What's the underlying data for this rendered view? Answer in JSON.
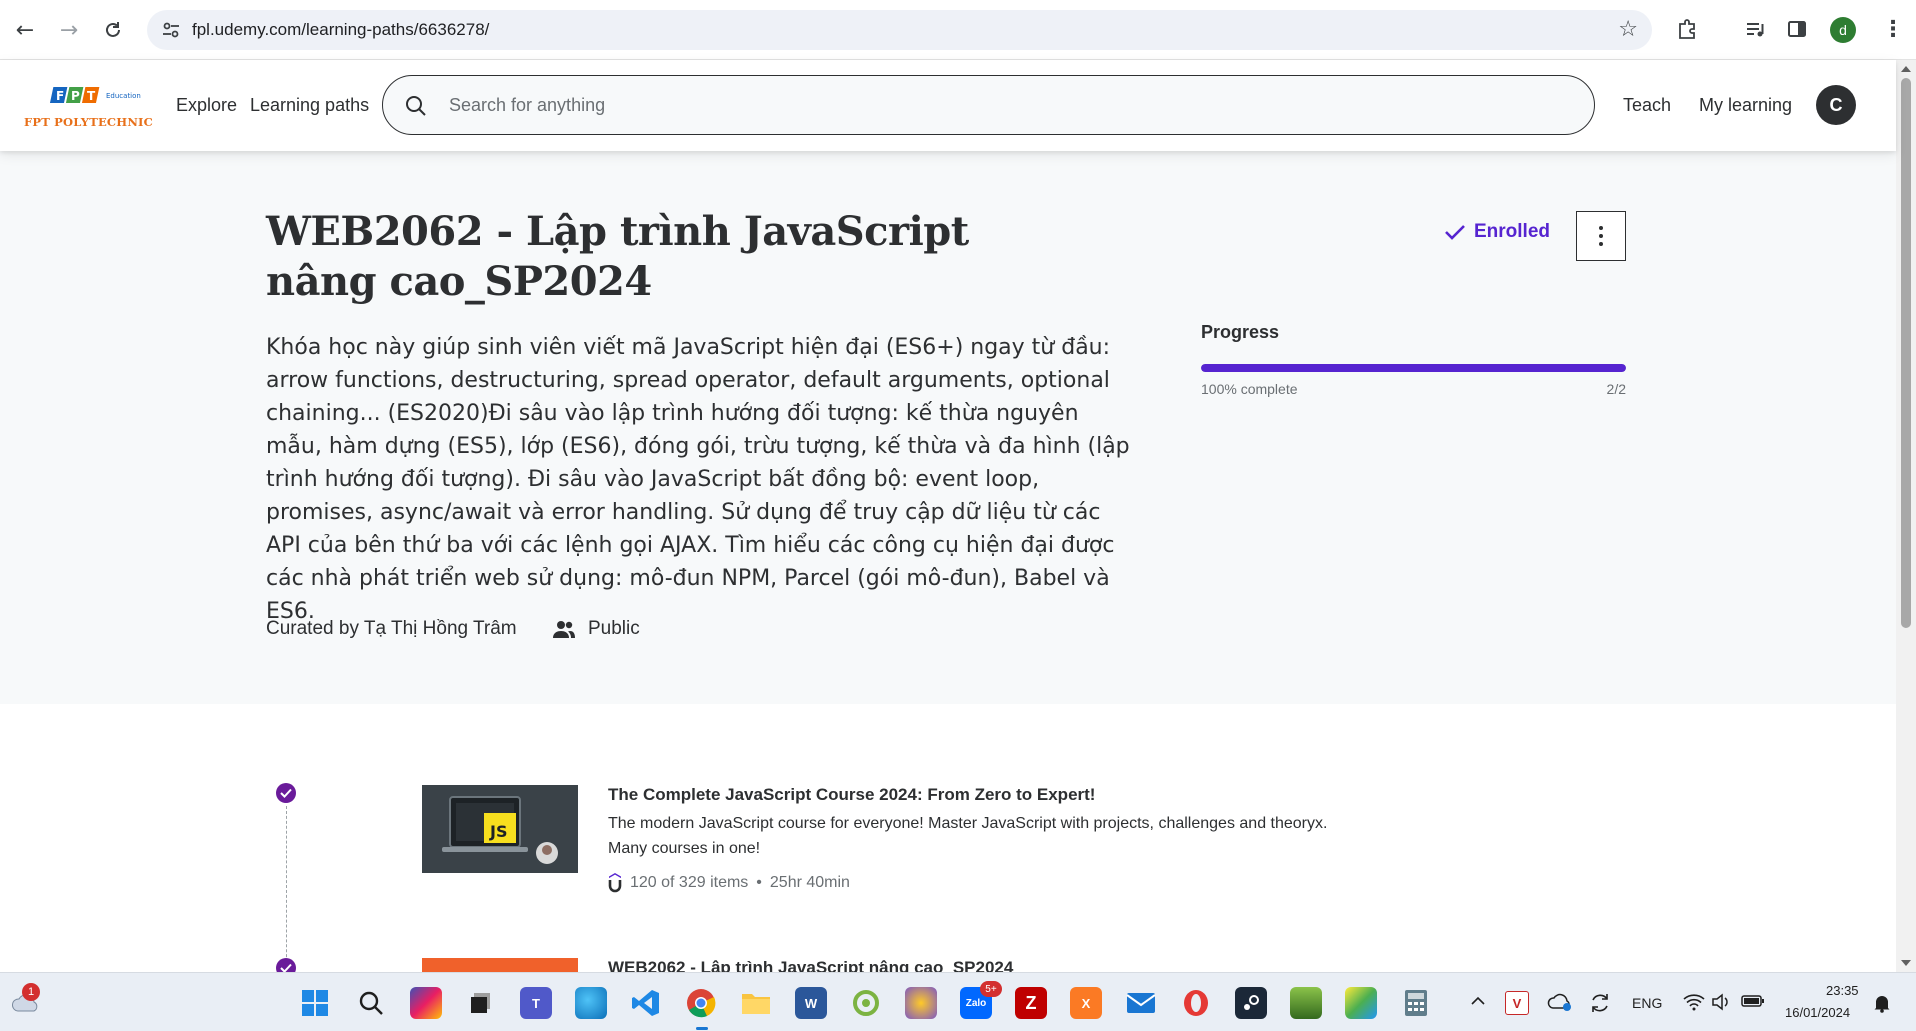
{
  "browser": {
    "url": "fpl.udemy.com/learning-paths/6636278/",
    "profile_initial": "d"
  },
  "header": {
    "logo_text": "FPT POLYTECHNIC",
    "logo_sub": "Education",
    "nav_explore": "Explore",
    "nav_learning_paths": "Learning paths",
    "search_placeholder": "Search for anything",
    "nav_teach": "Teach",
    "nav_my_learning": "My learning",
    "avatar_initial": "C"
  },
  "path": {
    "title": "WEB2062 - Lập trình JavaScript nâng cao_SP2024",
    "description": "Khóa học này giúp sinh viên viết mã JavaScript hiện đại (ES6+) ngay từ đầu: arrow functions, destructuring, spread operator, default arguments, optional chaining... (ES2020)Đi sâu vào lập trình hướng đối tượng: kế thừa nguyên mẫu, hàm dựng (ES5), lớp (ES6), đóng gói, trừu tượng, kế thừa và đa hình (lập trình hướng đối tượng). Đi sâu vào JavaScript bất đồng bộ: event loop, promises, async/await và error handling. Sử dụng để truy cập dữ liệu từ các API của bên thứ ba với các lệnh gọi AJAX. Tìm hiểu các công cụ hiện đại được các nhà phát triển web sử dụng: mô-đun NPM, Parcel (gói mô-đun), Babel và ES6.",
    "curated_by": "Curated by Tạ Thị Hồng Trâm",
    "visibility": "Public",
    "enrolled_label": "Enrolled",
    "progress_label": "Progress",
    "progress_percent": 100,
    "progress_text": "100% complete",
    "progress_count": "2/2"
  },
  "courses": [
    {
      "title": "The Complete JavaScript Course 2024: From Zero to Expert!",
      "description": "The modern JavaScript course for everyone! Master JavaScript with projects, challenges and theoryx. Many courses in one!",
      "items": "120 of 329 items",
      "separator": "•",
      "duration": "25hr 40min",
      "thumb_badge": "JS"
    },
    {
      "title": "WEB2062 - Lập trình JavaScript nâng cao_SP2024"
    }
  ],
  "taskbar": {
    "notification_count": "1",
    "zalo_badge": "5+",
    "language": "ENG",
    "time": "23:35",
    "date": "16/01/2024"
  },
  "colors": {
    "accent": "#5624d0",
    "check": "#6a1b9a",
    "logo_orange": "#e8701a"
  }
}
